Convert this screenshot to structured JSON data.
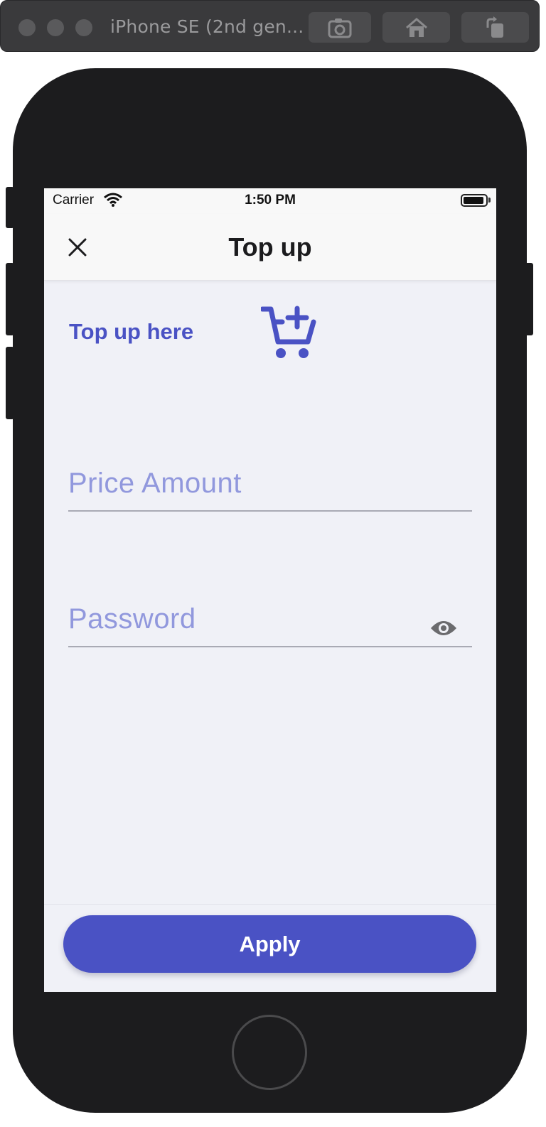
{
  "simulator": {
    "device_title": "iPhone SE (2nd gen...",
    "buttons": [
      "screenshot-icon",
      "home-icon",
      "rotate-icon"
    ]
  },
  "status_bar": {
    "carrier": "Carrier",
    "time": "1:50 PM"
  },
  "nav": {
    "title": "Top up",
    "close_icon": "close-icon"
  },
  "content": {
    "heading": "Top up here",
    "heading_icon": "cart-plus-icon",
    "fields": [
      {
        "label": "Price Amount",
        "value": ""
      },
      {
        "label": "Password",
        "value": "",
        "toggle_icon": "eye-icon"
      }
    ]
  },
  "footer": {
    "apply_label": "Apply"
  },
  "colors": {
    "accent": "#4a52c4",
    "placeholder": "#9198dd",
    "background": "#f0f1f7"
  }
}
